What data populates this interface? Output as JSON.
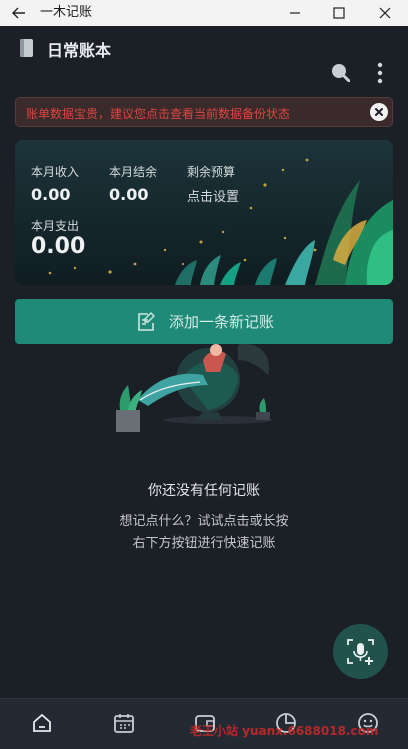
{
  "window": {
    "title": "一木记账"
  },
  "app": {
    "title": "日常账本"
  },
  "banner": {
    "text": "账单数据宝贵，建议您点击查看当前数据备份状态"
  },
  "summary": {
    "income_label": "本月收入",
    "income_value": "0.00",
    "balance_label": "本月结余",
    "balance_value": "0.00",
    "budget_label": "剩余预算",
    "budget_link": "点击设置",
    "expense_label": "本月支出",
    "expense_value": "0.00"
  },
  "add_button": {
    "label": "添加一条新记账"
  },
  "empty": {
    "title": "你还没有任何记账",
    "hint_line1": "想记点什么？试试点击或长按",
    "hint_line2": "右下方按钮进行快速记账"
  },
  "nav": {
    "items": [
      "home-icon",
      "calendar-icon",
      "wallet-icon",
      "pie-chart-icon",
      "smile-icon"
    ]
  },
  "watermark": {
    "text": "老王小站 yuanx.6688018.com"
  },
  "colors": {
    "background": "#1b1f26",
    "accent": "#1f8a77",
    "warning": "#d9473f",
    "fab": "#22524c"
  }
}
